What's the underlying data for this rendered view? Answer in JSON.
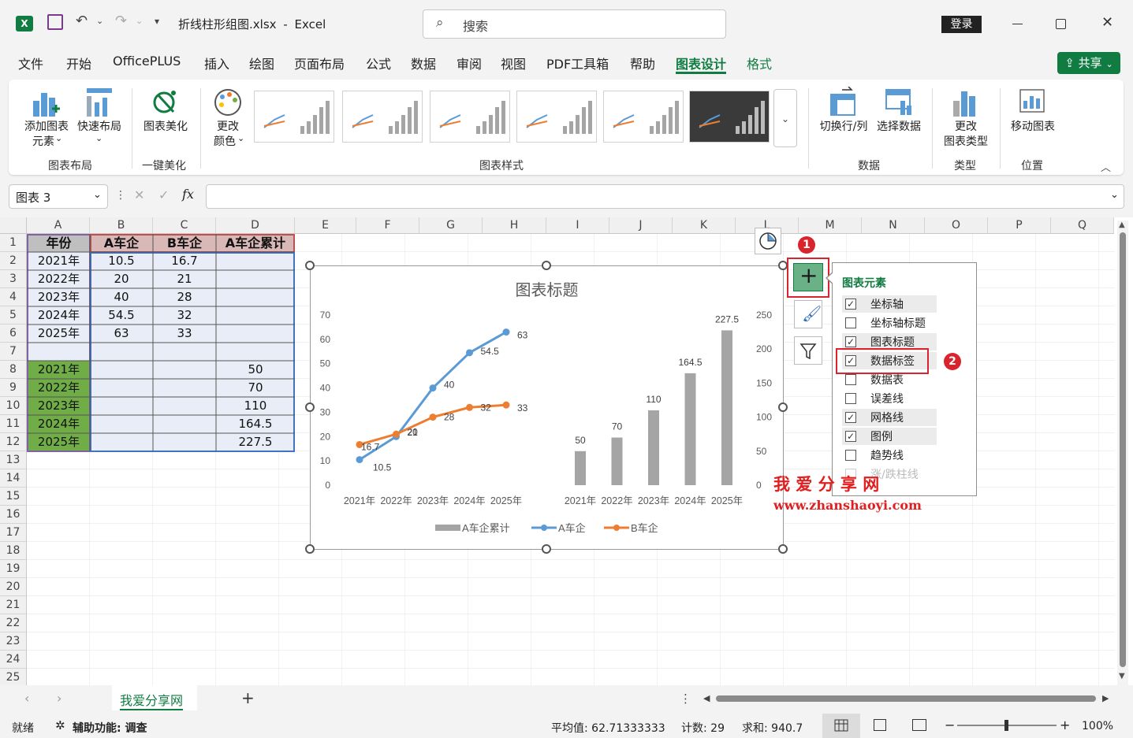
{
  "titlebar": {
    "filename": "折线柱形组图.xlsx",
    "app": "Excel",
    "search_placeholder": "搜索",
    "login": "登录"
  },
  "menu": {
    "tabs": [
      "文件",
      "开始",
      "OfficePLUS",
      "插入",
      "绘图",
      "页面布局",
      "公式",
      "数据",
      "审阅",
      "视图",
      "PDF工具箱",
      "帮助",
      "图表设计",
      "格式"
    ],
    "active": "图表设计",
    "share": "共享"
  },
  "ribbon": {
    "add_element": "添加图表\n元素",
    "add_element_l1": "添加图表",
    "add_element_l2": "元素",
    "quick_layout": "快速布局",
    "beautify": "图表美化",
    "change_color_l1": "更改",
    "change_color_l2": "颜色",
    "switch_rowcol": "切换行/列",
    "select_data": "选择数据",
    "change_type_l1": "更改",
    "change_type_l2": "图表类型",
    "move_chart": "移动图表",
    "groups": {
      "layout": "图表布局",
      "beautify": "一键美化",
      "styles": "图表样式",
      "data": "数据",
      "type": "类型",
      "location": "位置"
    }
  },
  "formula_bar": {
    "namebox": "图表 3",
    "fx": "fx",
    "value": ""
  },
  "columns": [
    "A",
    "B",
    "C",
    "D",
    "E",
    "F",
    "G",
    "H",
    "I",
    "J",
    "K",
    "L",
    "M",
    "N",
    "O",
    "P",
    "Q"
  ],
  "rows": [
    "1",
    "2",
    "3",
    "4",
    "5",
    "6",
    "7",
    "8",
    "9",
    "10",
    "11",
    "12",
    "13",
    "14",
    "15",
    "16",
    "17",
    "18",
    "19",
    "20",
    "21",
    "22",
    "23",
    "24",
    "25"
  ],
  "table": {
    "headers": [
      "年份",
      "A车企",
      "B车企",
      "A车企累计"
    ],
    "rows1": [
      [
        "2021年",
        "10.5",
        "16.7"
      ],
      [
        "2022年",
        "20",
        "21"
      ],
      [
        "2023年",
        "40",
        "28"
      ],
      [
        "2024年",
        "54.5",
        "32"
      ],
      [
        "2025年",
        "63",
        "33"
      ]
    ],
    "rows2": [
      [
        "2021年",
        "50"
      ],
      [
        "2022年",
        "70"
      ],
      [
        "2023年",
        "110"
      ],
      [
        "2024年",
        "164.5"
      ],
      [
        "2025年",
        "227.5"
      ]
    ]
  },
  "chart_data": {
    "type": "combo",
    "title": "图表标题",
    "line_categories": [
      "2021年",
      "2022年",
      "2023年",
      "2024年",
      "2025年"
    ],
    "bar_categories": [
      "2021年",
      "2022年",
      "2023年",
      "2024年",
      "2025年"
    ],
    "series": [
      {
        "name": "A车企累计",
        "kind": "bar",
        "axis": "secondary",
        "values": [
          50,
          70,
          110,
          164.5,
          227.5
        ],
        "color": "#a5a5a5"
      },
      {
        "name": "A车企",
        "kind": "line",
        "axis": "primary",
        "values": [
          10.5,
          20,
          40,
          54.5,
          63
        ],
        "color": "#5b9bd5"
      },
      {
        "name": "B车企",
        "kind": "line",
        "axis": "primary",
        "values": [
          16.7,
          21,
          28,
          32,
          33
        ],
        "color": "#ed7d31"
      }
    ],
    "y_primary": {
      "range": [
        0,
        70
      ],
      "ticks": [
        "0",
        "10",
        "20",
        "30",
        "40",
        "50",
        "60",
        "70"
      ]
    },
    "y_secondary": {
      "range": [
        0,
        250
      ],
      "ticks": [
        "0",
        "50",
        "100",
        "150",
        "200",
        "250"
      ]
    },
    "legend": "bottom",
    "grid": false
  },
  "elements_panel": {
    "title": "图表元素",
    "items": [
      {
        "label": "坐标轴",
        "checked": true
      },
      {
        "label": "坐标轴标题",
        "checked": false
      },
      {
        "label": "图表标题",
        "checked": true
      },
      {
        "label": "数据标签",
        "checked": true
      },
      {
        "label": "数据表",
        "checked": false
      },
      {
        "label": "误差线",
        "checked": false
      },
      {
        "label": "网格线",
        "checked": true
      },
      {
        "label": "图例",
        "checked": true
      },
      {
        "label": "趋势线",
        "checked": false
      },
      {
        "label": "涨/跌柱线",
        "checked": false
      }
    ]
  },
  "annotations": {
    "badge1": "1",
    "badge2": "2"
  },
  "watermark": {
    "text1": "我 爱 分 享 网",
    "text2": "www.zhanshaoyi.com"
  },
  "sheet_tab": "我爱分享网",
  "status": {
    "ready": "就绪",
    "accessibility": "辅助功能: 调查",
    "average": "平均值: 62.71333333",
    "count": "计数: 29",
    "sum": "求和: 940.7",
    "zoom": "100%"
  }
}
